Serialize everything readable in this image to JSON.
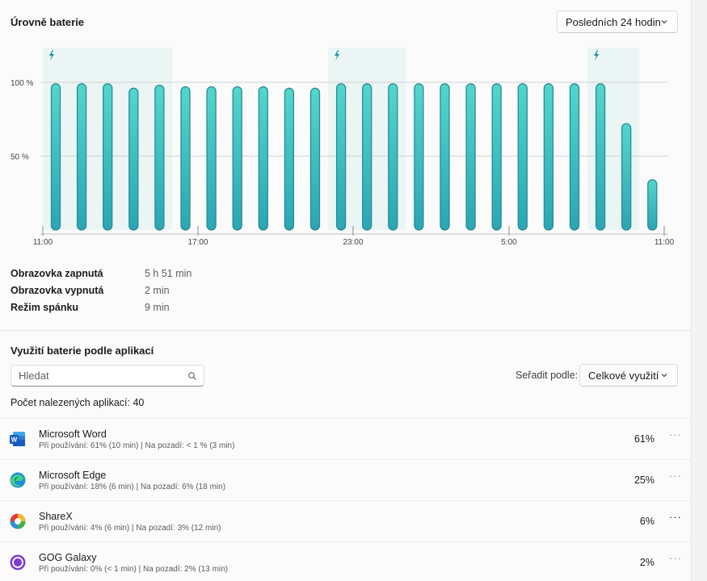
{
  "battery_levels": {
    "title": "Úrovně baterie",
    "range_select": "Posledních 24 hodin"
  },
  "chart_data": {
    "type": "bar",
    "ylabels": [
      "100 %",
      "50 %"
    ],
    "xlabels": [
      "11:00",
      "17:00",
      "23:00",
      "5:00",
      "11:00"
    ],
    "ylim": [
      0,
      100
    ],
    "grid": true,
    "values": [
      99,
      99,
      99,
      96,
      98,
      97,
      97,
      97,
      97,
      96,
      96,
      99,
      99,
      99,
      99,
      99,
      99,
      99,
      99,
      99,
      99,
      99,
      72,
      34
    ],
    "charging_periods": [
      [
        0,
        4
      ],
      [
        11,
        13
      ],
      [
        21,
        22
      ]
    ],
    "colors": {
      "bar_top": "#53d6cc",
      "bar_bottom": "#2aa6b3",
      "stroke": "#2a8b97",
      "charging_bg": "#eaf5f4",
      "grid": "#d3d3d3",
      "bolt": "#1d8fa0"
    }
  },
  "stats": [
    {
      "label": "Obrazovka zapnutá",
      "value": "5 h 51 min"
    },
    {
      "label": "Obrazovka vypnutá",
      "value": "2 min"
    },
    {
      "label": "Režim spánku",
      "value": "9 min"
    }
  ],
  "apps_section": {
    "title": "Využití baterie podle aplikací",
    "search_placeholder": "Hledat",
    "sort_label": "Seřadit podle:",
    "sort_value": "Celkové využití",
    "count_text": "Počet nalezených aplikací: 40"
  },
  "apps": [
    {
      "name": "Microsoft Word",
      "detail": "Při používání: 61% (10 min) | Na pozadí: < 1 % (3 min)",
      "percent": "61%",
      "icon": "word-icon"
    },
    {
      "name": "Microsoft Edge",
      "detail": "Při používání: 18% (6 min) | Na pozadí: 6% (18 min)",
      "percent": "25%",
      "icon": "edge-icon"
    },
    {
      "name": "ShareX",
      "detail": "Při používání: 4% (6 min) | Na pozadí: 3% (12 min)",
      "percent": "6%",
      "icon": "sharex-icon"
    },
    {
      "name": "GOG Galaxy",
      "detail": "Při používání: 0% (< 1 min) | Na pozadí: 2% (13 min)",
      "percent": "2%",
      "icon": "gog-galaxy-icon"
    }
  ],
  "more_label": "···"
}
